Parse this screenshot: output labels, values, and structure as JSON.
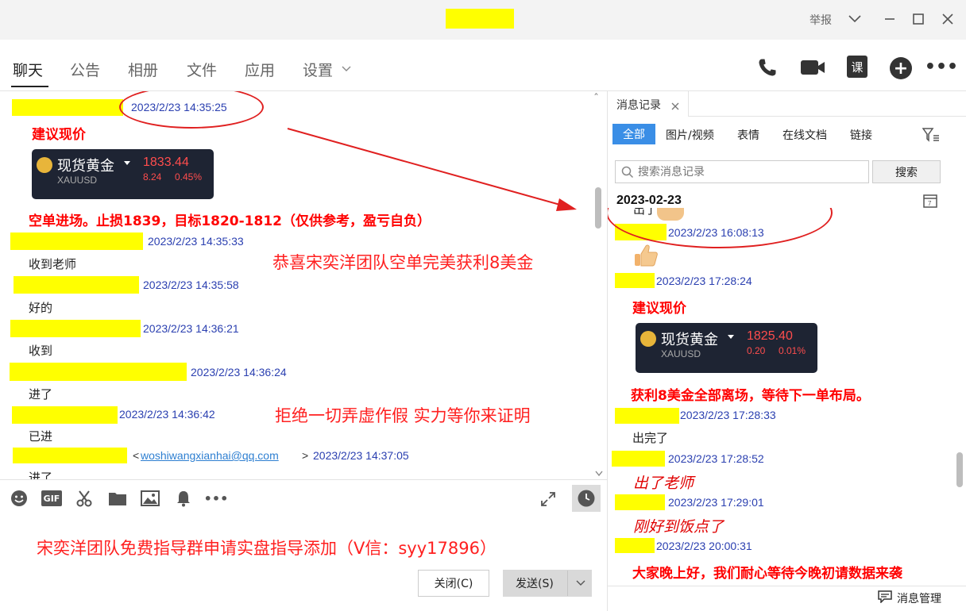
{
  "title_bar": {
    "report_label": "举报"
  },
  "tabs": [
    "聊天",
    "公告",
    "相册",
    "文件",
    "应用",
    "设置"
  ],
  "chat": {
    "ts1": "2023/2/23 14:35:25",
    "suggest_price": "建议现价",
    "gold_card_1": {
      "name": "现货黄金",
      "ticker": "XAUUSD",
      "price": "1833.44",
      "change": "8.24",
      "percent": "0.45%"
    },
    "short_entry": "空单进场。止损1839，目标1820-1812（仅供参考，盈亏自负）",
    "ts2": "2023/2/23 14:35:33",
    "msg2": "收到老师",
    "ts3": "2023/2/23 14:35:58",
    "msg3": "好的",
    "ts4": "2023/2/23 14:36:21",
    "msg4": "收到",
    "ts5": "2023/2/23 14:36:24",
    "msg5": "进了",
    "ts6": "2023/2/23 14:36:42",
    "msg6": "已进",
    "email_open": "<",
    "email": "woshiwangxianhai@qq.com",
    "email_close": ">",
    "ts7": "2023/2/23 14:37:05",
    "msg7": "进了",
    "overlay_congrats": "恭喜宋奕洋团队空单完美获利8美金",
    "overlay_refuse": "拒绝一切弄虚作假 实力等你来证明"
  },
  "compose": {
    "text": "宋奕洋团队免费指导群申请实盘指导添加（V信：syy17896）",
    "close_label": "关闭(C)",
    "send_label": "发送(S)"
  },
  "history": {
    "tab_label": "消息记录",
    "filters": [
      "全部",
      "图片/视频",
      "表情",
      "在线文档",
      "链接"
    ],
    "search_placeholder": "搜索消息记录",
    "search_button": "搜索",
    "date": "2023-02-23",
    "partial_msg": "出了",
    "ts1": "2023/2/23 16:08:13",
    "ts2": "2023/2/23 17:28:24",
    "suggest_price": "建议现价",
    "gold_card_2": {
      "name": "现货黄金",
      "ticker": "XAUUSD",
      "price": "1825.40",
      "change": "0.20",
      "percent": "0.01%"
    },
    "profit_msg": "获利8美金全部离场，等待下一单布局。",
    "ts3": "2023/2/23 17:28:33",
    "msg3": "出完了",
    "ts4": "2023/2/23 17:28:52",
    "msg4": "出了老师",
    "ts5": "2023/2/23 17:29:01",
    "msg5": "刚好到饭点了",
    "ts6": "2023/2/23 20:00:31",
    "msg6": "大家晚上好，我们耐心等待今晚初请数据来袭",
    "manage_label": "消息管理"
  },
  "colors": {
    "highlight": "#ffff00",
    "timestamp": "#2a3fb0",
    "accent_red": "#ff0000",
    "filter_active": "#3a8ee6"
  }
}
